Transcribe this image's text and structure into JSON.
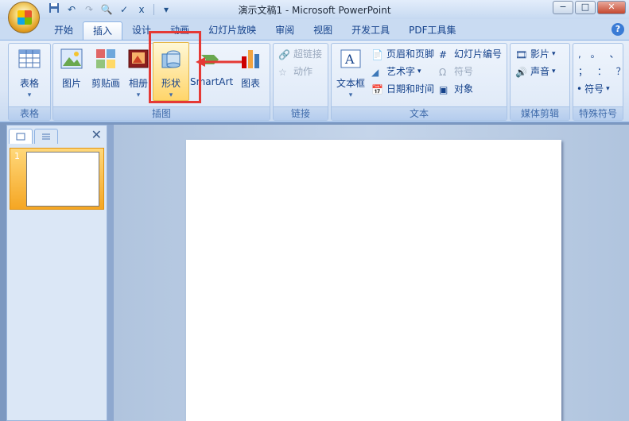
{
  "window": {
    "title": "演示文稿1 - Microsoft PowerPoint"
  },
  "qat": {
    "items": [
      "save-icon",
      "undo-icon",
      "redo-icon",
      "print-preview-icon",
      "spelling-icon",
      "dropdown-icon"
    ]
  },
  "tabs": [
    {
      "label": "开始"
    },
    {
      "label": "插入",
      "active": true
    },
    {
      "label": "设计"
    },
    {
      "label": "动画"
    },
    {
      "label": "幻灯片放映"
    },
    {
      "label": "审阅"
    },
    {
      "label": "视图"
    },
    {
      "label": "开发工具"
    },
    {
      "label": "PDF工具集"
    }
  ],
  "ribbon": {
    "tables": {
      "label": "表格",
      "button": "表格"
    },
    "illustrations": {
      "label": "插图",
      "picture": "图片",
      "clipart": "剪贴画",
      "album": "相册",
      "shapes": "形状",
      "smartart": "SmartArt",
      "chart": "图表"
    },
    "links": {
      "label": "链接",
      "hyperlink": "超链接",
      "action": "动作"
    },
    "text": {
      "label": "文本",
      "textbox": "文本框",
      "header_footer": "页眉和页脚",
      "wordart": "艺术字",
      "datetime": "日期和时间",
      "slide_number": "幻灯片编号",
      "symbol": "符号",
      "object": "对象"
    },
    "media": {
      "label": "媒体剪辑",
      "movie": "影片",
      "sound": "声音"
    },
    "special": {
      "label": "特殊符号",
      "symbol": "符号",
      "chars_row1": ", 。 、",
      "chars_row2": "； ： ？"
    }
  },
  "slides_panel": {
    "slide_number": "1"
  },
  "colors": {
    "highlight": "#ffd56a",
    "annotation": "#e53935",
    "accent": "#15428b"
  }
}
